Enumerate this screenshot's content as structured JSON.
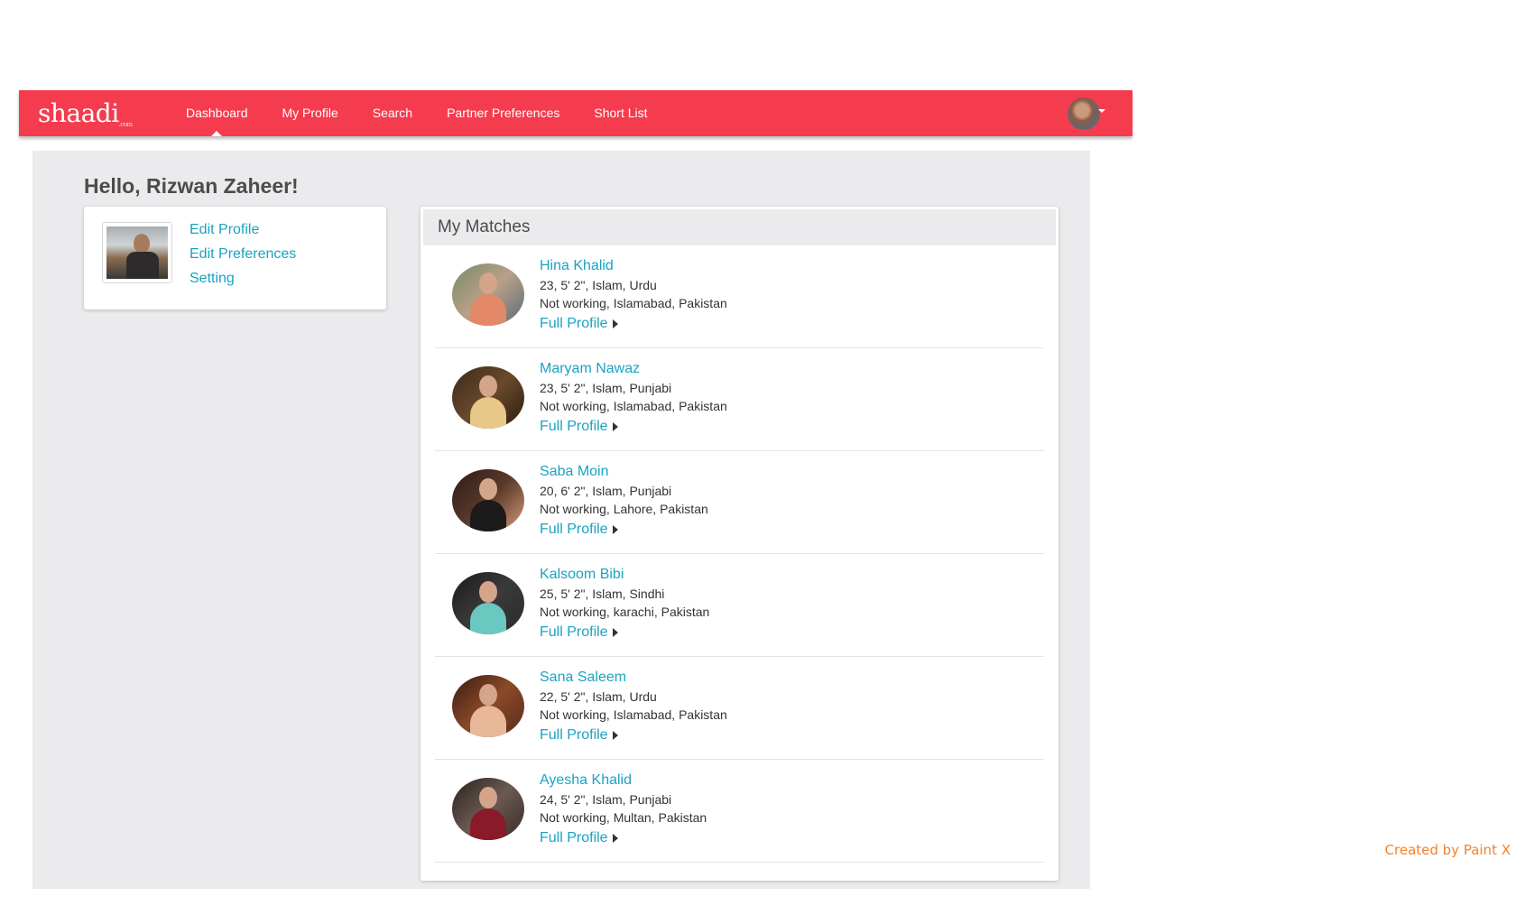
{
  "app": {
    "logo": "shaadi",
    "logo_suffix": ".com"
  },
  "nav": {
    "items": [
      {
        "label": "Dashboard",
        "active": true
      },
      {
        "label": "My Profile",
        "active": false
      },
      {
        "label": "Search",
        "active": false
      },
      {
        "label": "Partner Preferences",
        "active": false
      },
      {
        "label": "Short List",
        "active": false
      }
    ],
    "accent_color": "#f43c4e"
  },
  "greeting": "Hello, Rizwan Zaheer!",
  "profile_card": {
    "links": [
      "Edit Profile",
      "Edit Preferences",
      "Setting"
    ]
  },
  "matches": {
    "title": "My Matches",
    "link_label": "Full Profile",
    "items": [
      {
        "name": "Hina Khalid",
        "details": "23, 5' 2\", Islam, Urdu",
        "location": "Not working, Islamabad, Pakistan"
      },
      {
        "name": "Maryam Nawaz",
        "details": "23, 5' 2\", Islam, Punjabi",
        "location": "Not working, Islamabad, Pakistan"
      },
      {
        "name": "Saba Moin",
        "details": "20, 6' 2\", Islam, Punjabi",
        "location": "Not working, Lahore, Pakistan"
      },
      {
        "name": "Kalsoom Bibi",
        "details": "25, 5' 2\", Islam, Sindhi",
        "location": "Not working, karachi, Pakistan"
      },
      {
        "name": "Sana Saleem",
        "details": "22, 5' 2\", Islam, Urdu",
        "location": "Not working, Islamabad, Pakistan"
      },
      {
        "name": "Ayesha Khalid",
        "details": "24, 5' 2\", Islam, Punjabi",
        "location": "Not working, Multan, Pakistan"
      }
    ]
  },
  "watermark": "Created by Paint X"
}
